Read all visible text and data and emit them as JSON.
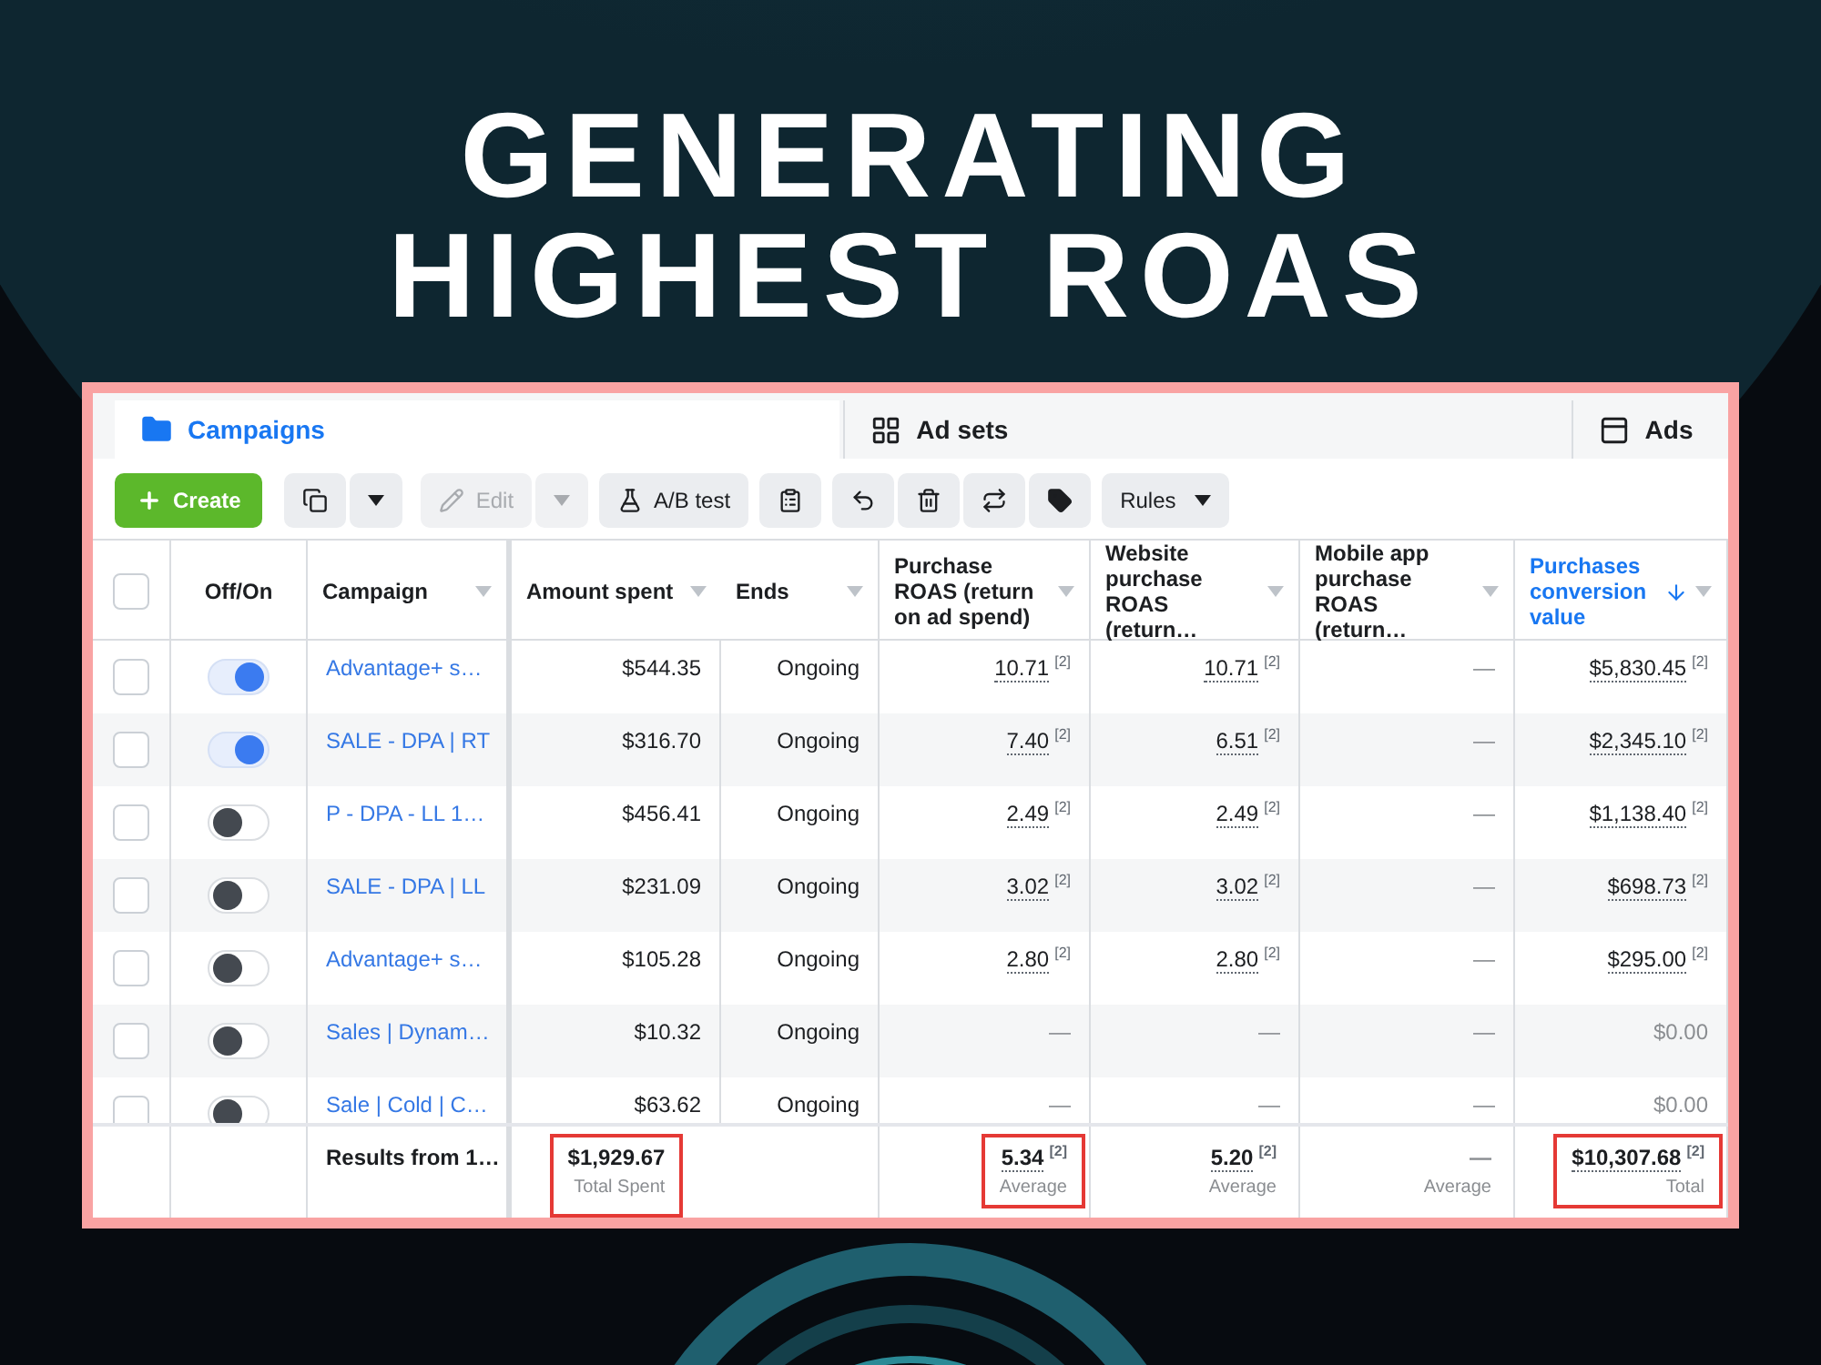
{
  "headline": [
    "GENERATING",
    "HIGHEST ROAS"
  ],
  "tabs": [
    {
      "label": "Campaigns",
      "selected": true
    },
    {
      "label": "Ad sets",
      "selected": false
    },
    {
      "label": "Ads",
      "selected": false
    }
  ],
  "toolbar": {
    "create": "Create",
    "edit": "Edit",
    "ab_test": "A/B test",
    "rules": "Rules"
  },
  "select_all": {
    "checked": false
  },
  "columns": [
    {
      "label": "Off/On",
      "sortable": false,
      "sorted": false
    },
    {
      "label": "Campaign",
      "sortable": true,
      "sorted": false
    },
    {
      "label": "Amount spent",
      "sortable": true,
      "sorted": false
    },
    {
      "label": "Ends",
      "sortable": true,
      "sorted": false
    },
    {
      "label": "Purchase ROAS (return on ad spend)",
      "sortable": true,
      "sorted": false
    },
    {
      "label": "Website purchase ROAS (return…",
      "sortable": true,
      "sorted": false
    },
    {
      "label": "Mobile app purchase ROAS (return…",
      "sortable": true,
      "sorted": false
    },
    {
      "label": "Purchases conversion value",
      "sortable": true,
      "sorted": true
    }
  ],
  "rows": [
    {
      "checked": false,
      "on": true,
      "campaign": "Advantage+ s…",
      "spent": "$544.35",
      "ends": "Ongoing",
      "metrics": [
        {
          "value": "10.71",
          "note": "[2]"
        },
        {
          "value": "10.71",
          "note": "[2]"
        },
        {
          "value": "—"
        },
        {
          "value": "$5,830.45",
          "note": "[2]"
        }
      ]
    },
    {
      "checked": false,
      "on": true,
      "campaign": "SALE - DPA | RT",
      "spent": "$316.70",
      "ends": "Ongoing",
      "metrics": [
        {
          "value": "7.40",
          "note": "[2]"
        },
        {
          "value": "6.51",
          "note": "[2]"
        },
        {
          "value": "—"
        },
        {
          "value": "$2,345.10",
          "note": "[2]"
        }
      ]
    },
    {
      "checked": false,
      "on": false,
      "campaign": "P - DPA - LL 1…",
      "spent": "$456.41",
      "ends": "Ongoing",
      "metrics": [
        {
          "value": "2.49",
          "note": "[2]"
        },
        {
          "value": "2.49",
          "note": "[2]"
        },
        {
          "value": "—"
        },
        {
          "value": "$1,138.40",
          "note": "[2]"
        }
      ]
    },
    {
      "checked": false,
      "on": false,
      "campaign": "SALE - DPA | LL",
      "spent": "$231.09",
      "ends": "Ongoing",
      "metrics": [
        {
          "value": "3.02",
          "note": "[2]"
        },
        {
          "value": "3.02",
          "note": "[2]"
        },
        {
          "value": "—"
        },
        {
          "value": "$698.73",
          "note": "[2]"
        }
      ]
    },
    {
      "checked": false,
      "on": false,
      "campaign": "Advantage+ s…",
      "spent": "$105.28",
      "ends": "Ongoing",
      "metrics": [
        {
          "value": "2.80",
          "note": "[2]"
        },
        {
          "value": "2.80",
          "note": "[2]"
        },
        {
          "value": "—"
        },
        {
          "value": "$295.00",
          "note": "[2]"
        }
      ]
    },
    {
      "checked": false,
      "on": false,
      "campaign": "Sales | Dynam…",
      "spent": "$10.32",
      "ends": "Ongoing",
      "metrics": [
        {
          "value": "—"
        },
        {
          "value": "—"
        },
        {
          "value": "—"
        },
        {
          "value": "$0.00"
        }
      ]
    },
    {
      "checked": false,
      "on": false,
      "campaign": "Sale | Cold | C…",
      "spent": "$63.62",
      "ends": "Ongoing",
      "metrics": [
        {
          "value": "—"
        },
        {
          "value": "—"
        },
        {
          "value": "—"
        },
        {
          "value": "$0.00"
        }
      ]
    }
  ],
  "footer": {
    "label": "Results from 1…",
    "spent": {
      "value": "$1,929.67",
      "caption": "Total Spent",
      "highlighted": true
    },
    "metrics": [
      {
        "value": "5.34",
        "note": "[2]",
        "caption": "Average",
        "highlighted": true
      },
      {
        "value": "5.20",
        "note": "[2]",
        "caption": "Average",
        "highlighted": false
      },
      {
        "value": "—",
        "caption": "Average",
        "highlighted": false
      },
      {
        "value": "$10,307.68",
        "note": "[2]",
        "caption": "Total",
        "highlighted": true
      }
    ]
  }
}
